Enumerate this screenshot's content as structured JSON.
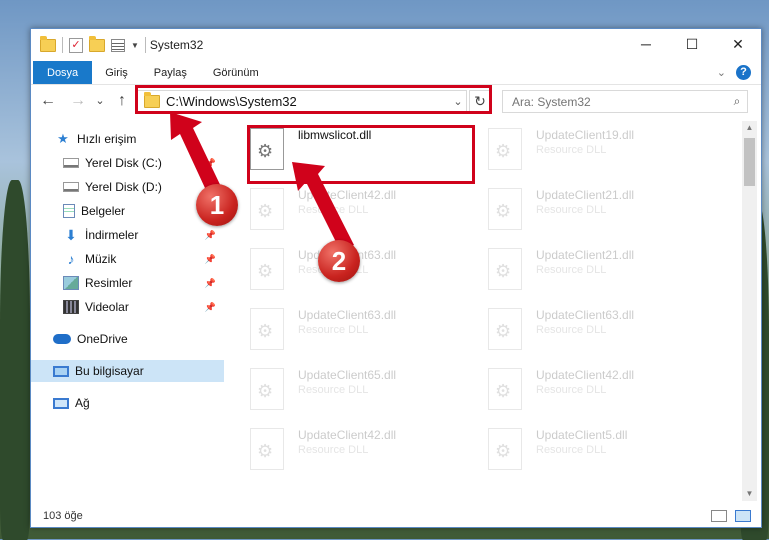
{
  "window": {
    "title": "System32",
    "controls": {
      "minimize": "─",
      "maximize": "☐",
      "close": "✕"
    }
  },
  "ribbon": {
    "tabs": [
      "Dosya",
      "Giriş",
      "Paylaş",
      "Görünüm"
    ],
    "expand_icon": "chevron-down-icon",
    "help": "?"
  },
  "nav": {
    "back": "←",
    "forward": "→",
    "recent": "⌄",
    "up": "↑",
    "address": "C:\\Windows\\System32",
    "address_dropdown": "⌄",
    "refresh": "↻",
    "search_placeholder": "Ara: System32"
  },
  "sidebar": {
    "items": [
      {
        "label": "Hızlı erişim",
        "icon": "star-icon",
        "pinned": false
      },
      {
        "label": "Yerel Disk (C:)",
        "icon": "drive-icon",
        "pinned": true
      },
      {
        "label": "Yerel Disk (D:)",
        "icon": "drive-icon",
        "pinned": true
      },
      {
        "label": "Belgeler",
        "icon": "document-icon",
        "pinned": true
      },
      {
        "label": "İndirmeler",
        "icon": "download-icon",
        "pinned": true
      },
      {
        "label": "Müzik",
        "icon": "music-icon",
        "pinned": true
      },
      {
        "label": "Resimler",
        "icon": "pictures-icon",
        "pinned": true
      },
      {
        "label": "Videolar",
        "icon": "video-icon",
        "pinned": true
      },
      {
        "label": "OneDrive",
        "icon": "cloud-icon",
        "pinned": false
      },
      {
        "label": "Bu bilgisayar",
        "icon": "computer-icon",
        "pinned": false,
        "selected": true
      },
      {
        "label": "Ağ",
        "icon": "network-icon",
        "pinned": false
      }
    ]
  },
  "files": {
    "left": [
      {
        "name": "libmwslicot.dll",
        "sub": ""
      },
      {
        "name": "UpdateClient42.dll",
        "sub": "Resource DLL"
      },
      {
        "name": "UpdateClient63.dll",
        "sub": "Resource DLL"
      },
      {
        "name": "UpdateClient63.dll",
        "sub": "Resource DLL"
      },
      {
        "name": "UpdateClient65.dll",
        "sub": "Resource DLL"
      },
      {
        "name": "UpdateClient42.dll",
        "sub": "Resource DLL"
      }
    ],
    "right": [
      {
        "name": "UpdateClient19.dll",
        "sub": "Resource DLL"
      },
      {
        "name": "UpdateClient21.dll",
        "sub": "Resource DLL"
      },
      {
        "name": "UpdateClient21.dll",
        "sub": "Resource DLL"
      },
      {
        "name": "UpdateClient63.dll",
        "sub": "Resource DLL"
      },
      {
        "name": "UpdateClient42.dll",
        "sub": "Resource DLL"
      },
      {
        "name": "UpdateClient5.dll",
        "sub": "Resource DLL"
      }
    ]
  },
  "status": {
    "count": "103 öğe"
  },
  "annotations": {
    "step1": "1",
    "step2": "2",
    "color": "#d0021b"
  }
}
